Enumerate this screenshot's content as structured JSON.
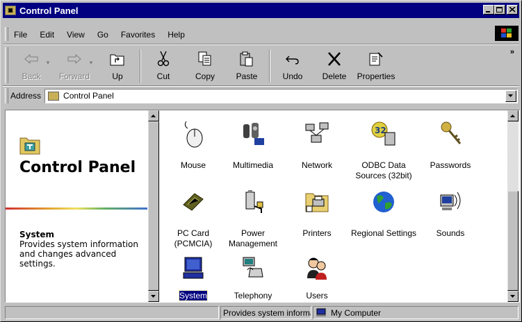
{
  "window": {
    "title": "Control Panel",
    "minimize_label": "_",
    "close_label": "x"
  },
  "menu": {
    "items": [
      {
        "label": "File"
      },
      {
        "label": "Edit"
      },
      {
        "label": "View"
      },
      {
        "label": "Go"
      },
      {
        "label": "Favorites"
      },
      {
        "label": "Help"
      }
    ]
  },
  "toolbar": {
    "back": "Back",
    "forward": "Forward",
    "up": "Up",
    "cut": "Cut",
    "copy": "Copy",
    "paste": "Paste",
    "undo": "Undo",
    "delete": "Delete",
    "properties": "Properties",
    "more": "»"
  },
  "address": {
    "label": "Address",
    "value": "Control Panel"
  },
  "left_pane": {
    "title": "Control Panel",
    "selected_name": "System",
    "selected_description": "Provides system information and changes advanced settings."
  },
  "items": [
    {
      "label": "Mouse",
      "icon": "mouse-icon"
    },
    {
      "label": "Multimedia",
      "icon": "multimedia-icon"
    },
    {
      "label": "Network",
      "icon": "network-icon"
    },
    {
      "label": "ODBC Data Sources (32bit)",
      "icon": "odbc-icon"
    },
    {
      "label": "Passwords",
      "icon": "keys-icon"
    },
    {
      "label": "PC Card (PCMCIA)",
      "icon": "pc-card-icon"
    },
    {
      "label": "Power Management",
      "icon": "power-icon"
    },
    {
      "label": "Printers",
      "icon": "printers-folder-icon"
    },
    {
      "label": "Regional Settings",
      "icon": "globe-icon"
    },
    {
      "label": "Sounds",
      "icon": "speaker-icon"
    },
    {
      "label": "System",
      "icon": "computer-icon",
      "selected": true
    },
    {
      "label": "Telephony",
      "icon": "telephony-icon"
    },
    {
      "label": "Users",
      "icon": "users-icon"
    }
  ],
  "status": {
    "description": "Provides system informal",
    "zone": "My Computer"
  },
  "colors": {
    "title_bar": "#000080",
    "face": "#c0c0c0",
    "selection": "#000080"
  }
}
